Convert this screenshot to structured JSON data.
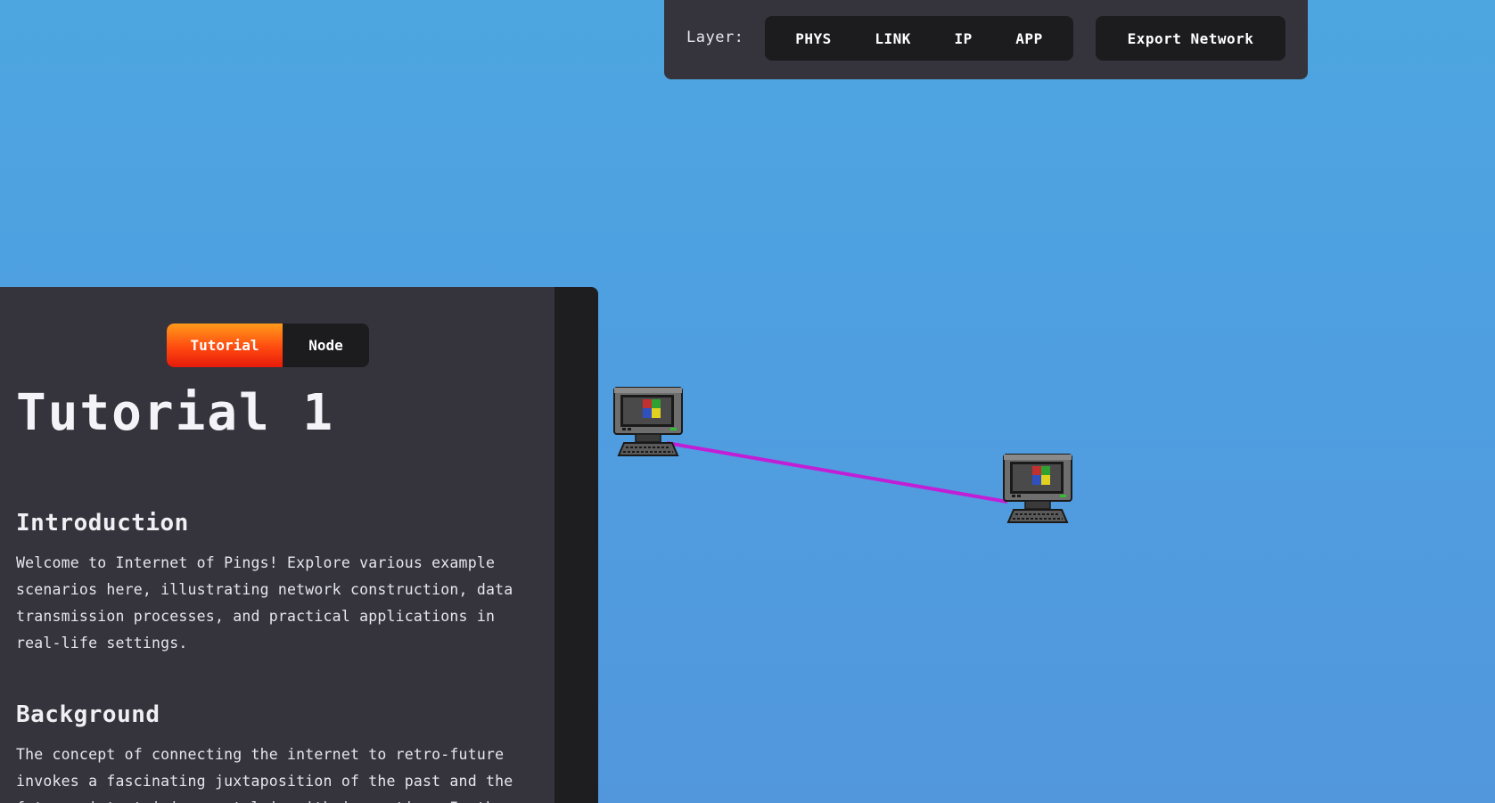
{
  "toolbar": {
    "layer_label": "Layer:",
    "layers": [
      "PHYS",
      "LINK",
      "IP",
      "APP"
    ],
    "export_label": "Export Network"
  },
  "panel": {
    "tabs": [
      {
        "label": "Tutorial",
        "active": true
      },
      {
        "label": "Node",
        "active": false
      }
    ],
    "title": "Tutorial 1",
    "sections": [
      {
        "heading": "Introduction",
        "body": "Welcome to Internet of Pings! Explore various example scenarios here, illustrating network construction, data transmission processes, and practical applications in real-life settings."
      },
      {
        "heading": "Background",
        "body": "The concept of connecting the internet to retro-future invokes a fascinating juxtaposition of the past and the future, intertwining nostalgia with innovation. In the"
      }
    ]
  },
  "network": {
    "nodes": [
      {
        "icon": "computer-icon"
      },
      {
        "icon": "computer-icon"
      }
    ],
    "link_color": "#c21ed6"
  },
  "colors": {
    "background": "#4fa0e0",
    "panel": "#35343d",
    "button_bg": "#1c1c1f",
    "tab_active_top": "#ff9a1a",
    "tab_active_bottom": "#e61a0a"
  }
}
